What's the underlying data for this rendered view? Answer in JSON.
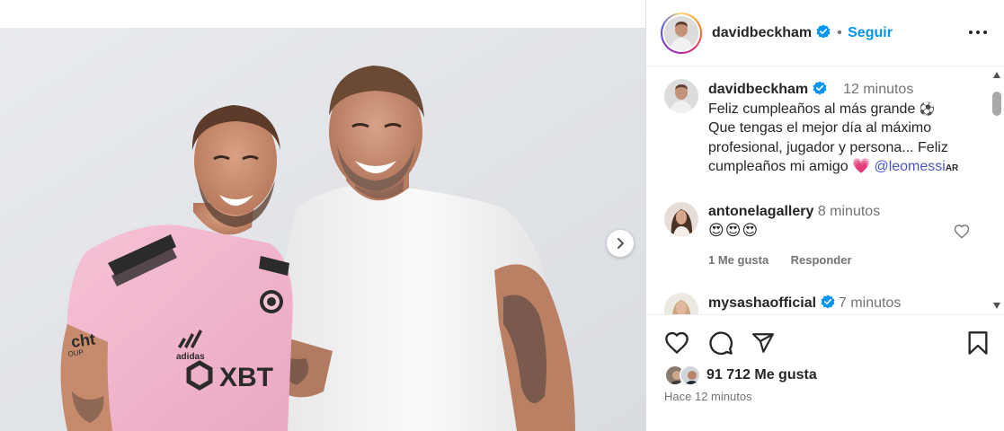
{
  "post": {
    "author": "davidbeckham",
    "follow_label": "Seguir",
    "separator": "•",
    "menu_icon": "more-horizontal-icon"
  },
  "caption": {
    "author": "davidbeckham",
    "time": "12 minutos",
    "lines": [
      "Feliz cumpleaños al más grande",
      "Que tengas el mejor día al máximo",
      "profesional, jugador y persona... Feliz",
      "cumpleaños mi amigo"
    ],
    "emoji_soccer": "⚽",
    "emoji_heart": "💗",
    "mention": "@leomessi",
    "flag_text": "AR"
  },
  "comments": [
    {
      "author": "antonelagallery",
      "time": "8 minutos",
      "text": "😍😍😍",
      "likes_label": "1 Me gusta",
      "reply_label": "Responder"
    },
    {
      "author": "mysashaofficial",
      "time": "7 minutos"
    }
  ],
  "engagement": {
    "likes": "91 712 Me gusta",
    "posted_ago": "Hace 12 minutos"
  },
  "photo": {
    "jersey_sponsor": "XBT",
    "jersey_brand": "adidas",
    "sleeve_text": "cht",
    "sleeve_text_2": "OUP"
  },
  "colors": {
    "verified": "#0095f6",
    "follow": "#0095f6",
    "mention": "#4a56c8",
    "jersey_pink": "#f4b8cf"
  }
}
